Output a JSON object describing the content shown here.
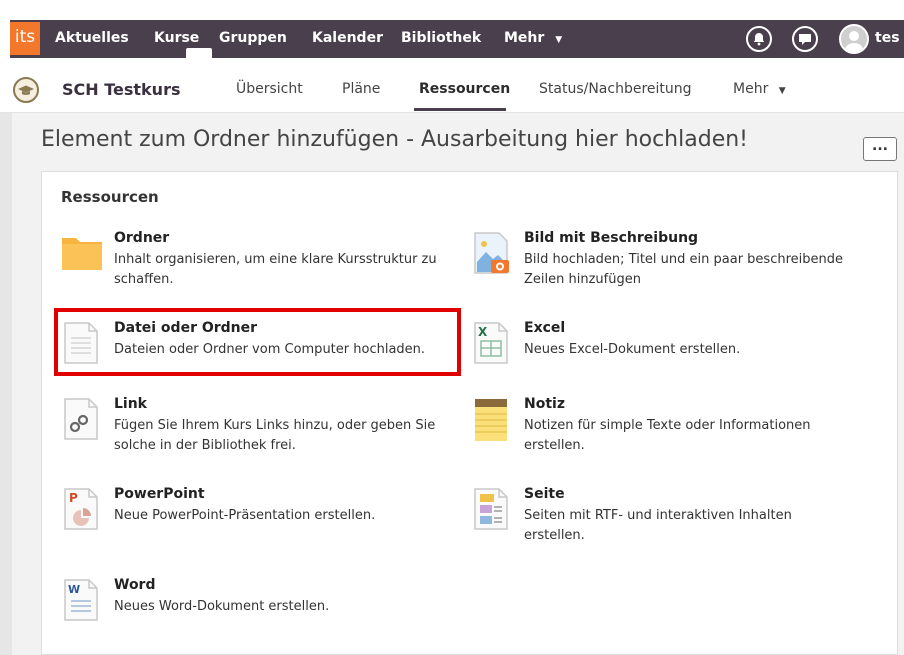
{
  "topnav": {
    "logo": "its",
    "items": [
      "Aktuelles",
      "Kurse",
      "Gruppen",
      "Kalender",
      "Bibliothek",
      "Mehr"
    ],
    "user": "tes"
  },
  "course": {
    "title": "SCH Testkurs",
    "tabs": [
      "Übersicht",
      "Pläne",
      "Ressourcen",
      "Status/Nachbereitung",
      "Mehr"
    ],
    "active_tab": "Ressourcen"
  },
  "page": {
    "title": "Element zum Ordner hinzufügen - Ausarbeitung hier hochladen!",
    "more_label": "..."
  },
  "resources": {
    "heading": "Ressourcen",
    "left": [
      {
        "title": "Ordner",
        "desc_l1": "Inhalt organisieren, um eine klare Kursstruktur zu",
        "desc_l2": "schaffen.",
        "icon": "folder-icon"
      },
      {
        "title": "Datei oder Ordner",
        "desc_l1": "Dateien oder Ordner vom Computer hochladen.",
        "desc_l2": "",
        "icon": "file-icon"
      },
      {
        "title": "Link",
        "desc_l1": "Fügen Sie Ihrem Kurs Links hinzu, oder geben Sie",
        "desc_l2": "solche in der Bibliothek frei.",
        "icon": "link-icon"
      },
      {
        "title": "PowerPoint",
        "desc_l1": "Neue PowerPoint-Präsentation erstellen.",
        "desc_l2": "",
        "icon": "powerpoint-icon"
      },
      {
        "title": "Word",
        "desc_l1": "Neues Word-Dokument erstellen.",
        "desc_l2": "",
        "icon": "word-icon"
      }
    ],
    "right": [
      {
        "title": "Bild mit Beschreibung",
        "desc_l1": "Bild hochladen; Titel und ein paar beschreibende",
        "desc_l2": "Zeilen hinzufügen",
        "icon": "image-icon"
      },
      {
        "title": "Excel",
        "desc_l1": "Neues Excel-Dokument erstellen.",
        "desc_l2": "",
        "icon": "excel-icon"
      },
      {
        "title": "Notiz",
        "desc_l1": "Notizen für simple Texte oder Informationen",
        "desc_l2": "erstellen.",
        "icon": "note-icon"
      },
      {
        "title": "Seite",
        "desc_l1": "Seiten mit RTF- und interaktiven Inhalten",
        "desc_l2": "erstellen.",
        "icon": "page-icon"
      }
    ]
  },
  "colors": {
    "topnav_bg": "#4a3f4d",
    "logo_bg": "#f4782b",
    "highlight": "#e00000"
  }
}
